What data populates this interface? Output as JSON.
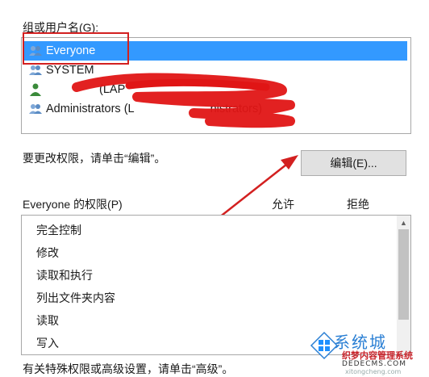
{
  "group_section": {
    "label": "组或用户名(G):",
    "users": [
      {
        "name": "Everyone",
        "selected": true
      },
      {
        "name": "SYSTEM",
        "selected": false
      },
      {
        "name": "(LAP",
        "selected": false
      },
      {
        "name": "Administrators (L",
        "suffix": "nistrators)",
        "selected": false
      }
    ]
  },
  "edit_hint": "要更改权限，请单击“编辑”。",
  "edit_button": "编辑(E)...",
  "permissions": {
    "label": "Everyone 的权限(P)",
    "allow_header": "允许",
    "deny_header": "拒绝",
    "items": [
      "完全控制",
      "修改",
      "读取和执行",
      "列出文件夹内容",
      "读取",
      "写入"
    ]
  },
  "footer_hint": "有关特殊权限或高级设置，请单击“高级”。",
  "watermark": {
    "title": "系统城",
    "line1": "织梦内容管理系统",
    "line2": "DEDECMS.COM",
    "line3": "xitongcheng.com"
  },
  "colors": {
    "selection": "#3399ff",
    "annotation": "#d32020",
    "button": "#e1e1e1"
  }
}
